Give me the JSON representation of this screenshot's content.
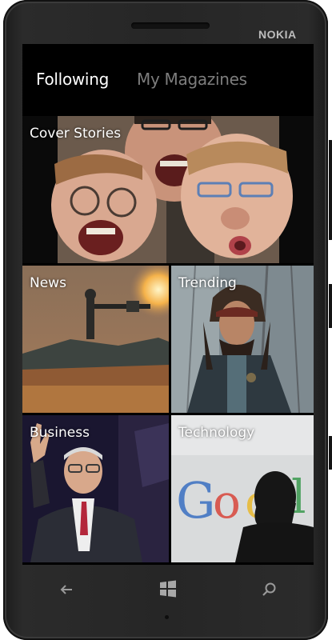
{
  "device": {
    "brand": "NOKIA"
  },
  "pivot": {
    "tabs": [
      {
        "label": "Following",
        "active": true
      },
      {
        "label": "My Magazines",
        "active": false
      }
    ]
  },
  "tiles": [
    {
      "label": "Cover Stories",
      "image": "three faces making funny expressions selfie"
    },
    {
      "label": "News",
      "image": "soldiers firing a mounted gun"
    },
    {
      "label": "Trending",
      "image": "pirate character portrait"
    },
    {
      "label": "Business",
      "image": "elderly man in suit waving"
    },
    {
      "label": "Technology",
      "image": "silhouette in front of colored logo letters"
    }
  ],
  "nav": {
    "back": "back-arrow-icon",
    "start": "windows-start-icon",
    "search": "search-icon"
  },
  "colors": {
    "screen_bg": "#000000",
    "active_tab": "#ffffff",
    "inactive_tab": "#7d7d7d",
    "phone_body": "#262626"
  }
}
